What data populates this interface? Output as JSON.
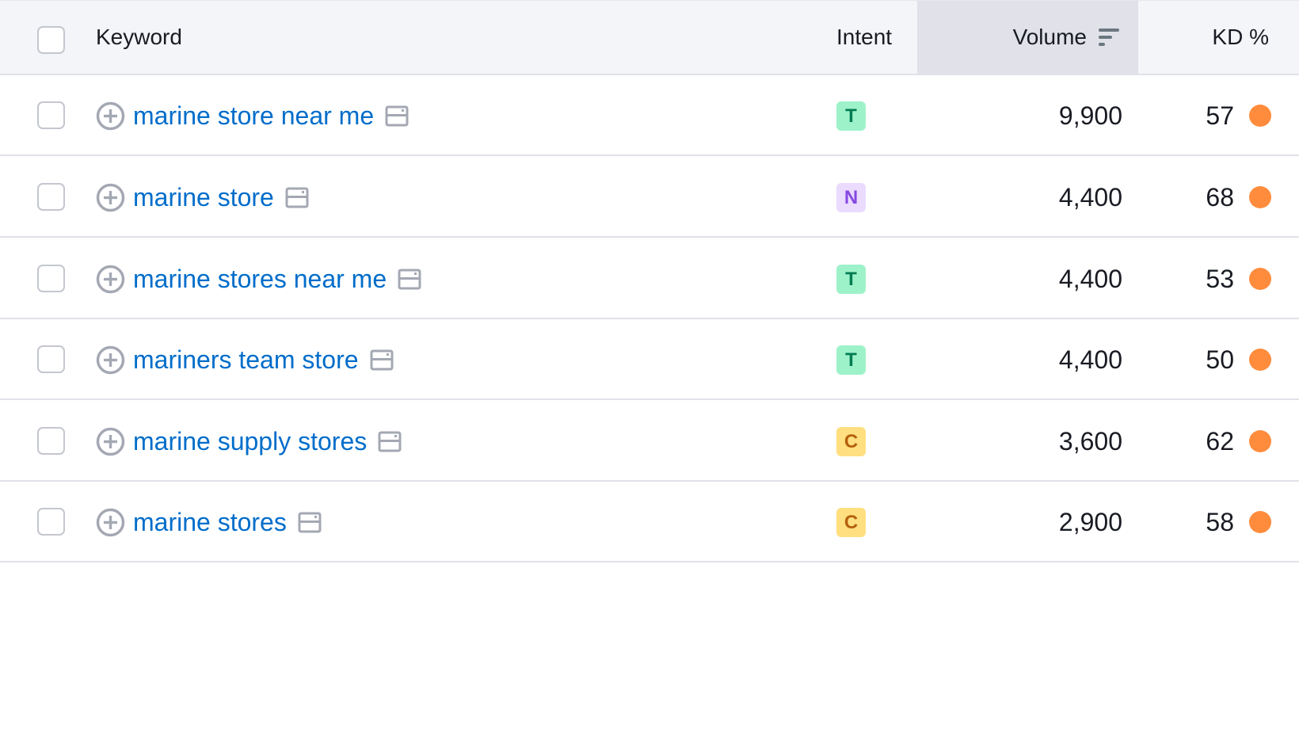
{
  "header": {
    "keyword": "Keyword",
    "intent": "Intent",
    "volume": "Volume",
    "kd": "KD %",
    "volume_sort_icon": "sort-descending-icon"
  },
  "colors": {
    "link": "#006dca",
    "kd_dot": "#ff8c3d",
    "T_bg": "#9ef2c9",
    "T_fg": "#007c52",
    "N_bg": "#eadbff",
    "N_fg": "#8649e1",
    "C_bg": "#ffdf80",
    "C_fg": "#b4600b"
  },
  "rows": [
    {
      "keyword": "marine store near me",
      "intent": "T",
      "volume": "9,900",
      "kd": "57"
    },
    {
      "keyword": "marine store",
      "intent": "N",
      "volume": "4,400",
      "kd": "68"
    },
    {
      "keyword": "marine stores near me",
      "intent": "T",
      "volume": "4,400",
      "kd": "53"
    },
    {
      "keyword": "mariners team store",
      "intent": "T",
      "volume": "4,400",
      "kd": "50"
    },
    {
      "keyword": "marine supply stores",
      "intent": "C",
      "volume": "3,600",
      "kd": "62"
    },
    {
      "keyword": "marine stores",
      "intent": "C",
      "volume": "2,900",
      "kd": "58"
    }
  ]
}
